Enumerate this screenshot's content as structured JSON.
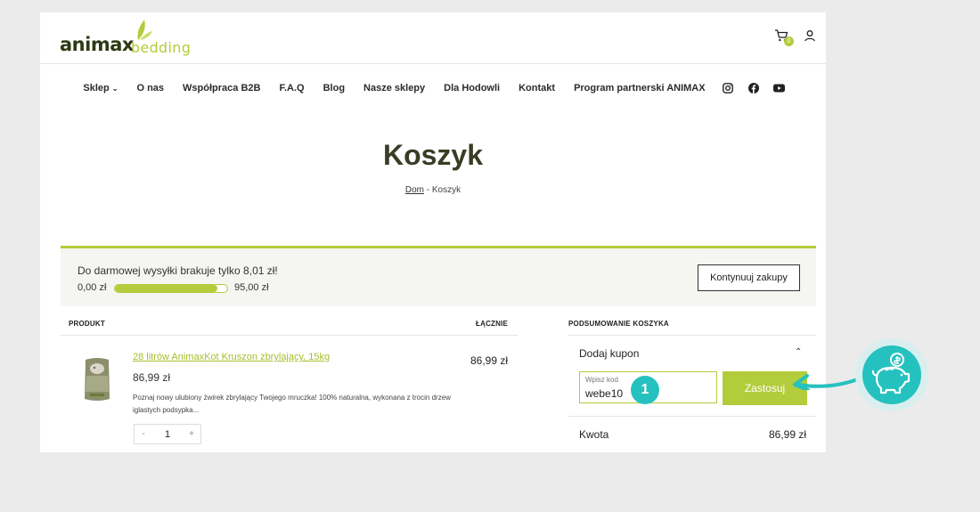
{
  "brand": {
    "name": "animax",
    "sub": "bedding"
  },
  "header": {
    "cart_count": "0"
  },
  "nav": {
    "items": [
      "Sklep",
      "O nas",
      "Współpraca B2B",
      "F.A.Q",
      "Blog",
      "Nasze sklepy",
      "Dla Hodowli",
      "Kontakt",
      "Program partnerski ANIMAX"
    ],
    "shop_chevron": "⌄"
  },
  "page": {
    "title": "Koszyk",
    "breadcrumb_home": "Dom",
    "breadcrumb_sep": " - ",
    "breadcrumb_current": "Koszyk"
  },
  "shipping": {
    "message": "Do darmowej wysyłki brakuje tylko 8,01 zł!",
    "from": "0,00 zł",
    "to": "95,00 zł",
    "progress_fraction": 0.916,
    "continue_label": "Kontynuuj zakupy"
  },
  "table": {
    "col_product": "PRODUKT",
    "col_total": "ŁĄCZNIE"
  },
  "product": {
    "name": "28 litrów AnimaxKot Kruszon zbrylający, 15kg",
    "price": "86,99 zł",
    "description": "Poznaj nowy ulubiony żwirek zbrylający Twojego mruczka! 100% naturalna, wykonana z trocin drzew iglastych podsypka...",
    "total": "86,99 zł",
    "qty": "1",
    "qty_minus": "-",
    "qty_plus": "+"
  },
  "summary": {
    "heading": "PODSUMOWANIE KOSZYKA",
    "coupon_label": "Dodaj kupon",
    "coupon_chevron": "⌃",
    "coupon_placeholder": "Wpisz kod",
    "coupon_value": "webe10",
    "apply_label": "Zastosuj",
    "amount_label": "Kwota",
    "amount_value": "86,99 zł"
  },
  "annotation": {
    "step": "1"
  },
  "colors": {
    "accent": "#b3cc3c",
    "teal": "#25c1bf",
    "dark": "#2e3a14"
  }
}
